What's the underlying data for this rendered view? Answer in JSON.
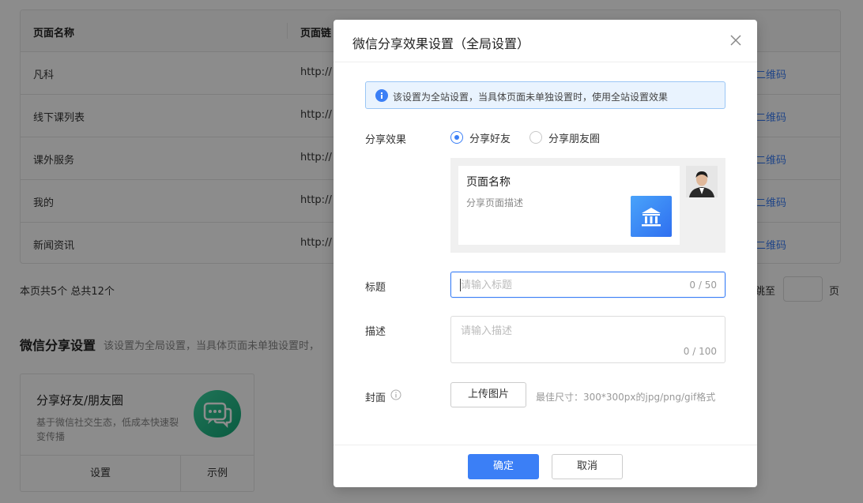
{
  "background": {
    "table": {
      "columns": [
        "页面名称",
        "页面链"
      ],
      "rows": [
        {
          "name": "凡科",
          "url": "http://",
          "action": "二维码"
        },
        {
          "name": "线下课列表",
          "url": "http://",
          "action": "二维码"
        },
        {
          "name": "课外服务",
          "url": "http://",
          "action": "二维码"
        },
        {
          "name": "我的",
          "url": "http://",
          "action": "二维码"
        },
        {
          "name": "新闻资讯",
          "url": "http://",
          "action": "二维码"
        }
      ]
    },
    "pagination": {
      "summary": "本页共5个 总共12个",
      "jump_label": "跳至",
      "page_unit": "页"
    },
    "section": {
      "title": "微信分享设置",
      "desc": "该设置为全局设置，当具体页面未单独设置时，"
    },
    "card": {
      "title": "分享好友/朋友圈",
      "desc": "基于微信社交生态，低成本快速裂变传播",
      "settings_button": "设置",
      "example_button": "示例"
    }
  },
  "modal": {
    "title": "微信分享效果设置（全局设置）",
    "notice": "该设置为全站设置，当具体页面未单独设置时，使用全站设置效果",
    "share_effect": {
      "label": "分享效果",
      "options": [
        "分享好友",
        "分享朋友圈"
      ],
      "selected": "分享好友"
    },
    "preview": {
      "title": "页面名称",
      "desc": "分享页面描述"
    },
    "title_field": {
      "label": "标题",
      "placeholder": "请输入标题",
      "counter": "0 / 50"
    },
    "desc_field": {
      "label": "描述",
      "placeholder": "请输入描述",
      "counter": "0 / 100"
    },
    "cover": {
      "label": "封面",
      "upload_button": "上传图片",
      "hint": "最佳尺寸：300*300px的jpg/png/gif格式"
    },
    "buttons": {
      "confirm": "确定",
      "cancel": "取消"
    }
  },
  "colors": {
    "primary": "#3b7ff6",
    "notice_bg": "#e9f3fe",
    "wechat_green": "#13a676"
  }
}
